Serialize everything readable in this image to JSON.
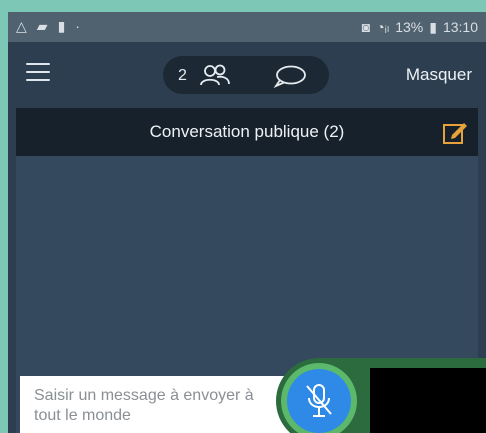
{
  "status_bar": {
    "battery_percent": "13%",
    "time": "13:10"
  },
  "toolbar": {
    "people_count": "2",
    "hide_label": "Masquer"
  },
  "chat": {
    "title": "Conversation publique (2)",
    "input_placeholder": "Saisir un message à envoyer à tout le monde"
  },
  "colors": {
    "background": "#2c3e50",
    "header": "#16212c",
    "accent": "#e8a23a",
    "mic_blue": "#2f89e6",
    "mic_ring": "#5cb86a"
  },
  "icons": {
    "menu": "hamburger-icon",
    "people": "people-icon",
    "chat": "chat-bubble-icon",
    "compose": "compose-icon",
    "mic": "mic-off-icon"
  }
}
